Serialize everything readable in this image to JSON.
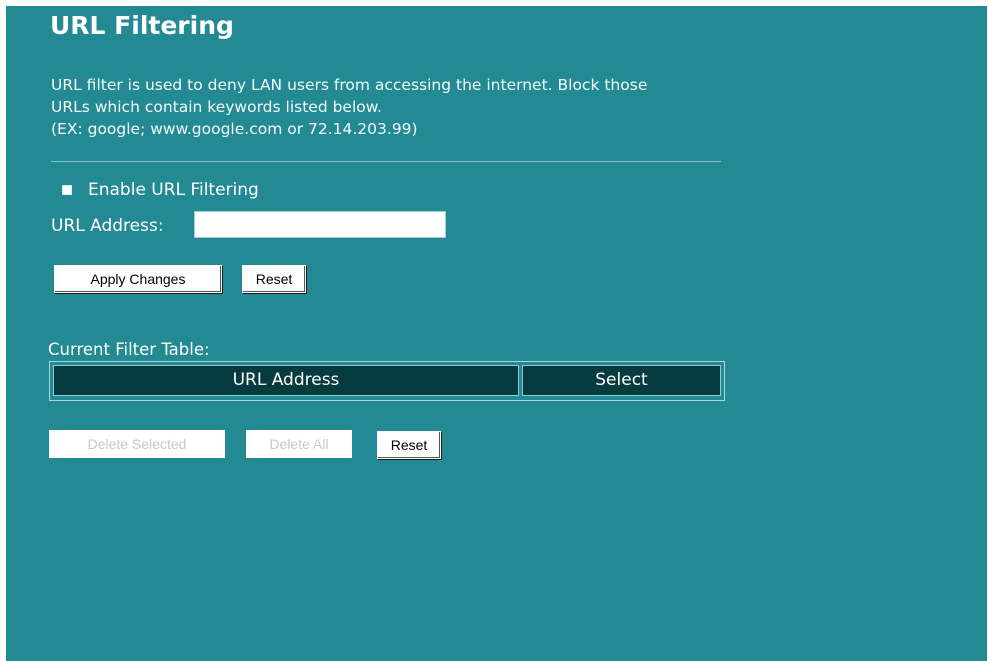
{
  "page": {
    "title": "URL Filtering",
    "description": [
      "URL filter is used to deny LAN users from accessing the internet. Block those",
      "URLs which contain keywords listed below.",
      "(EX: google; www.google.com or 72.14.203.99)"
    ]
  },
  "form": {
    "enable_label": "Enable URL Filtering",
    "enable_checked": false,
    "url_label": "URL Address:",
    "url_value": "",
    "url_placeholder": "",
    "apply_label": "Apply Changes",
    "reset_label": "Reset"
  },
  "filter_table": {
    "label": "Current Filter Table:",
    "columns": [
      "URL Address",
      "Select"
    ],
    "rows": []
  },
  "table_actions": {
    "delete_selected_label": "Delete Selected",
    "delete_all_label": "Delete All",
    "reset_label": "Reset"
  },
  "colors": {
    "background": "#238a93",
    "table_header": "#063c3f",
    "text": "#ffffff"
  }
}
